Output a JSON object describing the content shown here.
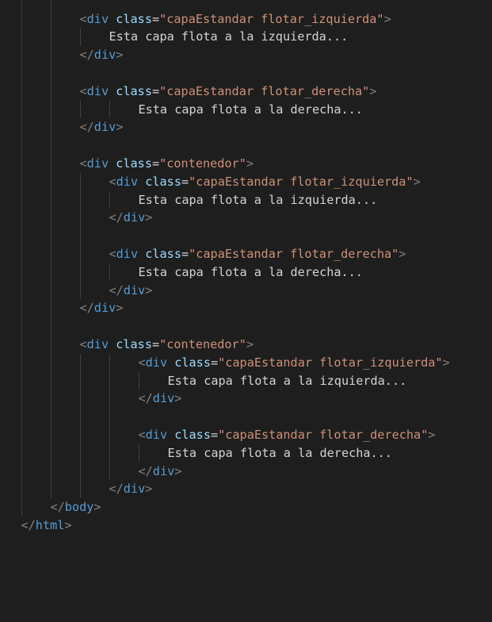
{
  "editor": {
    "colors": {
      "background": "#1e1e1e",
      "punctuation": "#808080",
      "tag": "#569cd6",
      "attribute": "#9cdcfe",
      "string": "#ce9178",
      "text": "#d4d4d4",
      "indent_guide": "#404040"
    },
    "lines": [
      {
        "indent": 2,
        "type": "open",
        "tag": "div",
        "attr": "class",
        "value": "\"capaEstandar flotar_izquierda\""
      },
      {
        "indent": 3,
        "type": "text",
        "text": "Esta capa flota a la izquierda..."
      },
      {
        "indent": 2,
        "type": "close",
        "tag": "div"
      },
      {
        "indent": 0,
        "type": "blank"
      },
      {
        "indent": 2,
        "type": "open",
        "tag": "div",
        "attr": "class",
        "value": "\"capaEstandar flotar_derecha\""
      },
      {
        "indent": 4,
        "type": "text",
        "text": "Esta capa flota a la derecha..."
      },
      {
        "indent": 2,
        "type": "close",
        "tag": "div"
      },
      {
        "indent": 0,
        "type": "blank"
      },
      {
        "indent": 2,
        "type": "open",
        "tag": "div",
        "attr": "class",
        "value": "\"contenedor\""
      },
      {
        "indent": 3,
        "type": "open",
        "tag": "div",
        "attr": "class",
        "value": "\"capaEstandar flotar_izquierda\""
      },
      {
        "indent": 4,
        "type": "text",
        "text": "Esta capa flota a la izquierda..."
      },
      {
        "indent": 3,
        "type": "close",
        "tag": "div"
      },
      {
        "indent": 0,
        "type": "blank"
      },
      {
        "indent": 3,
        "type": "open",
        "tag": "div",
        "attr": "class",
        "value": "\"capaEstandar flotar_derecha\""
      },
      {
        "indent": 4,
        "type": "text",
        "text": "Esta capa flota a la derecha..."
      },
      {
        "indent": 3,
        "type": "close",
        "tag": "div"
      },
      {
        "indent": 2,
        "type": "close",
        "tag": "div"
      },
      {
        "indent": 0,
        "type": "blank"
      },
      {
        "indent": 2,
        "type": "open",
        "tag": "div",
        "attr": "class",
        "value": "\"contenedor\""
      },
      {
        "indent": 4,
        "type": "open",
        "tag": "div",
        "attr": "class",
        "value": "\"capaEstandar flotar_izquierda\""
      },
      {
        "indent": 5,
        "type": "text",
        "text": "Esta capa flota a la izquierda..."
      },
      {
        "indent": 4,
        "type": "close",
        "tag": "div"
      },
      {
        "indent": 0,
        "type": "blank"
      },
      {
        "indent": 4,
        "type": "open",
        "tag": "div",
        "attr": "class",
        "value": "\"capaEstandar flotar_derecha\""
      },
      {
        "indent": 5,
        "type": "text",
        "text": "Esta capa flota a la derecha..."
      },
      {
        "indent": 4,
        "type": "close",
        "tag": "div"
      },
      {
        "indent": 3,
        "type": "close",
        "tag": "div"
      },
      {
        "indent": 1,
        "type": "close",
        "tag": "body"
      },
      {
        "indent": 0,
        "type": "close",
        "tag": "html"
      }
    ]
  }
}
